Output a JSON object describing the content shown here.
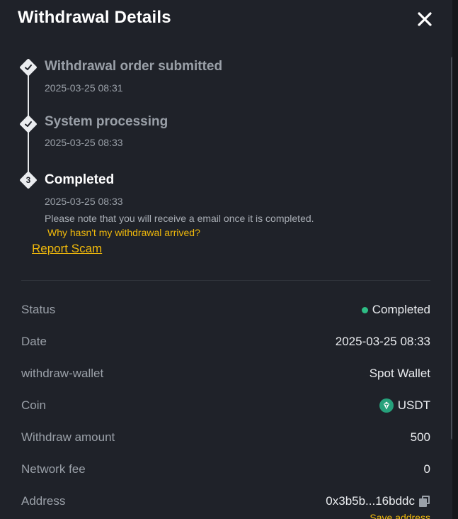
{
  "header": {
    "title": "Withdrawal Details"
  },
  "timeline": {
    "steps": [
      {
        "title": "Withdrawal order submitted",
        "time": "2025-03-25 08:31",
        "state": "done"
      },
      {
        "title": "System processing",
        "time": "2025-03-25 08:33",
        "state": "done"
      },
      {
        "title": "Completed",
        "time": "2025-03-25 08:33",
        "state": "current",
        "number": "3"
      }
    ],
    "note": "Please note that you will receive a email once it is completed.",
    "why_link": "Why hasn't my withdrawal arrived?",
    "report_link": "Report Scam"
  },
  "details": {
    "status": {
      "label": "Status",
      "value": "Completed",
      "color": "#2ebd85"
    },
    "date": {
      "label": "Date",
      "value": "2025-03-25 08:33"
    },
    "wallet": {
      "label": "withdraw-wallet",
      "value": "Spot Wallet"
    },
    "coin": {
      "label": "Coin",
      "value": "USDT",
      "icon": "tether-icon"
    },
    "amount": {
      "label": "Withdraw amount",
      "value": "500"
    },
    "fee": {
      "label": "Network fee",
      "value": "0"
    },
    "address": {
      "label": "Address",
      "value": "0x3b5b...16bddc",
      "save_label": "Save address"
    }
  },
  "colors": {
    "accent": "#f0b90b",
    "success": "#2ebd85",
    "background": "#1f2229"
  }
}
